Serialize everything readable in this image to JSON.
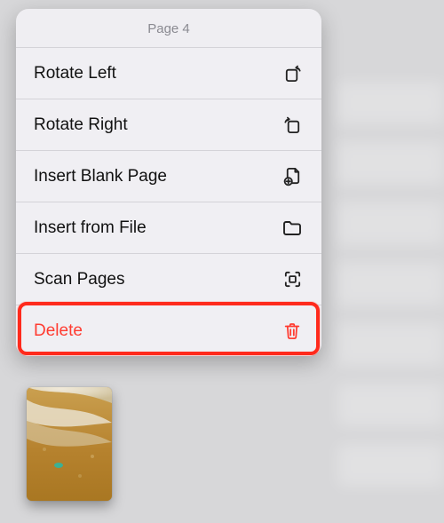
{
  "menu": {
    "title": "Page 4",
    "items": [
      {
        "label": "Rotate Left",
        "icon": "rotate-left-icon",
        "danger": false
      },
      {
        "label": "Rotate Right",
        "icon": "rotate-right-icon",
        "danger": false
      },
      {
        "label": "Insert Blank Page",
        "icon": "insert-page-icon",
        "danger": false
      },
      {
        "label": "Insert from File",
        "icon": "folder-icon",
        "danger": false
      },
      {
        "label": "Scan Pages",
        "icon": "scan-icon",
        "danger": false
      },
      {
        "label": "Delete",
        "icon": "trash-icon",
        "danger": true
      }
    ]
  },
  "colors": {
    "danger": "#ff3b30"
  },
  "highlighted_index": 5
}
